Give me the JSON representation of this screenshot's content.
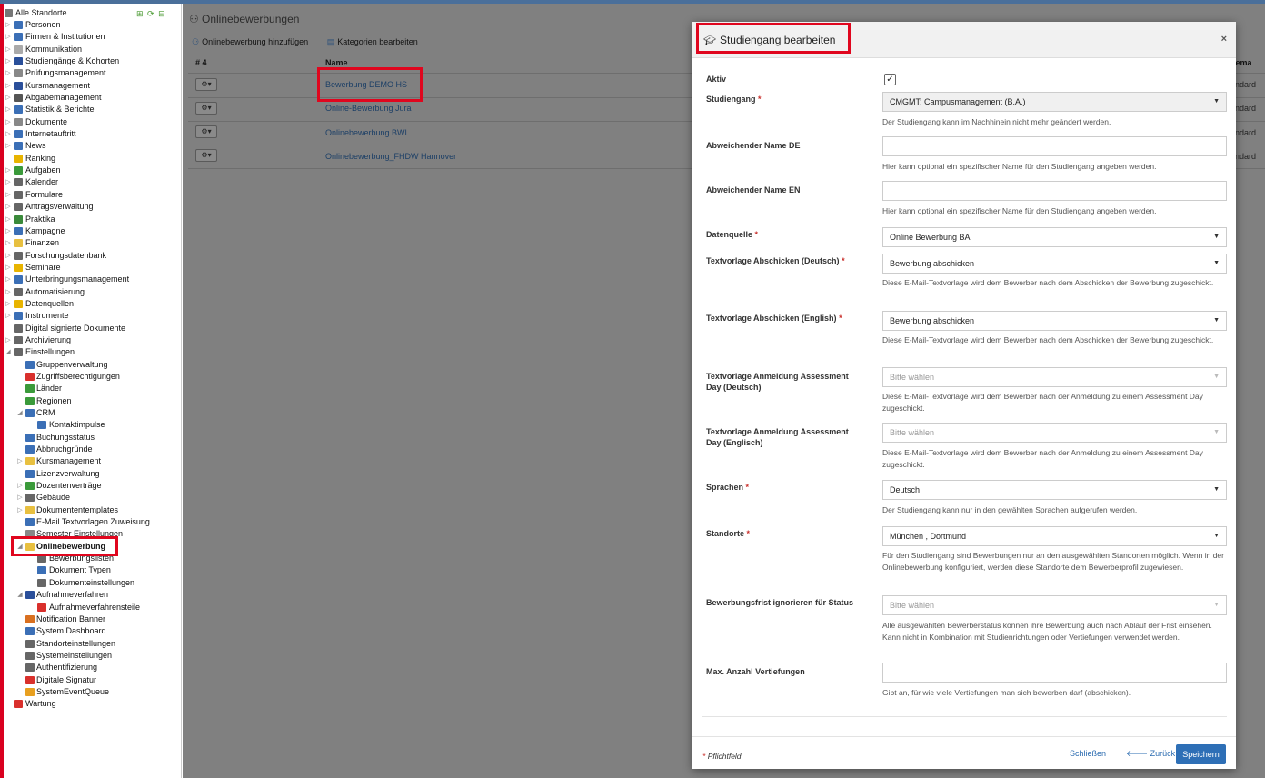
{
  "sidebar": {
    "root_label": "Alle Standorte",
    "items": [
      {
        "label": "Personen",
        "level": 0,
        "icon": "persons-icon",
        "color": "#3b6fb6",
        "arrow": "▷"
      },
      {
        "label": "Firmen & Institutionen",
        "level": 0,
        "icon": "company-icon",
        "color": "#3b6fb6",
        "arrow": "▷"
      },
      {
        "label": "Kommunikation",
        "level": 0,
        "icon": "mail-icon",
        "color": "#aaaaaa",
        "arrow": "▷"
      },
      {
        "label": "Studiengänge & Kohorten",
        "level": 0,
        "icon": "study-icon",
        "color": "#2a4f9a",
        "arrow": "▷"
      },
      {
        "label": "Prüfungsmanagement",
        "level": 0,
        "icon": "exam-icon",
        "color": "#888888",
        "arrow": "▷"
      },
      {
        "label": "Kursmanagement",
        "level": 0,
        "icon": "course-icon",
        "color": "#2a4f9a",
        "arrow": "▷"
      },
      {
        "label": "Abgabemanagement",
        "level": 0,
        "icon": "submission-icon",
        "color": "#555555",
        "arrow": "▷"
      },
      {
        "label": "Statistik & Berichte",
        "level": 0,
        "icon": "chart-icon",
        "color": "#3b6fb6",
        "arrow": "▷"
      },
      {
        "label": "Dokumente",
        "level": 0,
        "icon": "folder-icon",
        "color": "#888888",
        "arrow": "▷"
      },
      {
        "label": "Internetauftritt",
        "level": 0,
        "icon": "globe-icon",
        "color": "#3b6fb6",
        "arrow": "▷"
      },
      {
        "label": "News",
        "level": 0,
        "icon": "info-icon",
        "color": "#3b6fb6",
        "arrow": "▷"
      },
      {
        "label": "Ranking",
        "level": 0,
        "icon": "star-icon",
        "color": "#e8b400",
        "arrow": ""
      },
      {
        "label": "Aufgaben",
        "level": 0,
        "icon": "tasks-icon",
        "color": "#3a9a3a",
        "arrow": "▷"
      },
      {
        "label": "Kalender",
        "level": 0,
        "icon": "calendar-icon",
        "color": "#666666",
        "arrow": "▷"
      },
      {
        "label": "Formulare",
        "level": 0,
        "icon": "form-icon",
        "color": "#666666",
        "arrow": "▷"
      },
      {
        "label": "Antragsverwaltung",
        "level": 0,
        "icon": "application-icon",
        "color": "#666666",
        "arrow": "▷"
      },
      {
        "label": "Praktika",
        "level": 0,
        "icon": "internship-icon",
        "color": "#3a8a3a",
        "arrow": "▷"
      },
      {
        "label": "Kampagne",
        "level": 0,
        "icon": "campaign-icon",
        "color": "#3b6fb6",
        "arrow": "▷"
      },
      {
        "label": "Finanzen",
        "level": 0,
        "icon": "finance-icon",
        "color": "#e8c040",
        "arrow": "▷"
      },
      {
        "label": "Forschungsdatenbank",
        "level": 0,
        "icon": "research-icon",
        "color": "#666666",
        "arrow": "▷"
      },
      {
        "label": "Seminare",
        "level": 0,
        "icon": "seminar-icon",
        "color": "#e8b400",
        "arrow": "▷"
      },
      {
        "label": "Unterbringungsmanagement",
        "level": 0,
        "icon": "building-icon",
        "color": "#3b6fb6",
        "arrow": "▷"
      },
      {
        "label": "Automatisierung",
        "level": 0,
        "icon": "gear-icon",
        "color": "#666666",
        "arrow": "▷"
      },
      {
        "label": "Datenquellen",
        "level": 0,
        "icon": "datasource-icon",
        "color": "#e8b400",
        "arrow": "▷"
      },
      {
        "label": "Instrumente",
        "level": 0,
        "icon": "instruments-icon",
        "color": "#3b6fb6",
        "arrow": "▷"
      },
      {
        "label": "Digital signierte Dokumente",
        "level": 0,
        "icon": "signed-doc-icon",
        "color": "#666666",
        "arrow": ""
      },
      {
        "label": "Archivierung",
        "level": 0,
        "icon": "archive-icon",
        "color": "#666666",
        "arrow": "▷"
      },
      {
        "label": "Einstellungen",
        "level": 0,
        "icon": "gear-icon",
        "color": "#666666",
        "arrow": "◢"
      },
      {
        "label": "Gruppenverwaltung",
        "level": 1,
        "icon": "group-icon",
        "color": "#3b6fb6",
        "arrow": ""
      },
      {
        "label": "Zugriffsberechtigungen",
        "level": 1,
        "icon": "shield-icon",
        "color": "#d9302c",
        "arrow": ""
      },
      {
        "label": "Länder",
        "level": 1,
        "icon": "globe-icon",
        "color": "#3a9a3a",
        "arrow": ""
      },
      {
        "label": "Regionen",
        "level": 1,
        "icon": "globe-icon",
        "color": "#3a9a3a",
        "arrow": ""
      },
      {
        "label": "CRM",
        "level": 1,
        "icon": "tag-icon",
        "color": "#3b6fb6",
        "arrow": "◢"
      },
      {
        "label": "Kontaktimpulse",
        "level": 2,
        "icon": "tag-icon",
        "color": "#3b6fb6",
        "arrow": ""
      },
      {
        "label": "Buchungsstatus",
        "level": 1,
        "icon": "tag-icon",
        "color": "#3b6fb6",
        "arrow": ""
      },
      {
        "label": "Abbruchgründe",
        "level": 1,
        "icon": "tag-icon",
        "color": "#3b6fb6",
        "arrow": ""
      },
      {
        "label": "Kursmanagement",
        "level": 1,
        "icon": "folder-icon",
        "color": "#e8c040",
        "arrow": "▷"
      },
      {
        "label": "Lizenzverwaltung",
        "level": 1,
        "icon": "tag-icon",
        "color": "#3b6fb6",
        "arrow": ""
      },
      {
        "label": "Dozentenverträge",
        "level": 1,
        "icon": "contract-icon",
        "color": "#3a9a3a",
        "arrow": "▷"
      },
      {
        "label": "Gebäude",
        "level": 1,
        "icon": "house-icon",
        "color": "#666666",
        "arrow": "▷"
      },
      {
        "label": "Dokumententemplates",
        "level": 1,
        "icon": "folder-icon",
        "color": "#e8c040",
        "arrow": "▷"
      },
      {
        "label": "E-Mail Textvorlagen Zuweisung",
        "level": 1,
        "icon": "at-icon",
        "color": "#3b6fb6",
        "arrow": ""
      },
      {
        "label": "Semester Einstellungen",
        "level": 1,
        "icon": "semester-icon",
        "color": "#888888",
        "arrow": ""
      },
      {
        "label": "Onlinebewerbung",
        "level": 1,
        "icon": "application-icon",
        "color": "#e8c040",
        "arrow": "◢",
        "selected": true
      },
      {
        "label": "Bewerbungslisten",
        "level": 2,
        "icon": "list-icon",
        "color": "#666666",
        "arrow": ""
      },
      {
        "label": "Dokument Typen",
        "level": 2,
        "icon": "doc-type-icon",
        "color": "#3b6fb6",
        "arrow": ""
      },
      {
        "label": "Dokumenteinstellungen",
        "level": 2,
        "icon": "doc-settings-icon",
        "color": "#666666",
        "arrow": ""
      },
      {
        "label": "Aufnahmeverfahren",
        "level": 1,
        "icon": "admission-icon",
        "color": "#2a4f9a",
        "arrow": "◢"
      },
      {
        "label": "Aufnahmeverfahrensteile",
        "level": 2,
        "icon": "admission-part-icon",
        "color": "#d9302c",
        "arrow": ""
      },
      {
        "label": "Notification Banner",
        "level": 1,
        "icon": "bell-icon",
        "color": "#d97020",
        "arrow": ""
      },
      {
        "label": "System Dashboard",
        "level": 1,
        "icon": "dashboard-icon",
        "color": "#3b6fb6",
        "arrow": ""
      },
      {
        "label": "Standorteinstellungen",
        "level": 1,
        "icon": "gear-icon",
        "color": "#666666",
        "arrow": ""
      },
      {
        "label": "Systemeinstellungen",
        "level": 1,
        "icon": "gear-icon",
        "color": "#666666",
        "arrow": ""
      },
      {
        "label": "Authentifizierung",
        "level": 1,
        "icon": "gear-icon",
        "color": "#666666",
        "arrow": ""
      },
      {
        "label": "Digitale Signatur",
        "level": 1,
        "icon": "shield-icon",
        "color": "#d9302c",
        "arrow": ""
      },
      {
        "label": "SystemEventQueue",
        "level": 1,
        "icon": "queue-icon",
        "color": "#e8a020",
        "arrow": ""
      },
      {
        "label": "Wartung",
        "level": 0,
        "icon": "maintenance-icon",
        "color": "#d9302c",
        "arrow": ""
      }
    ]
  },
  "page": {
    "title": "Onlinebewerbungen",
    "toolbar": {
      "add_label": "Onlinebewerbung hinzufügen",
      "categories_label": "Kategorien bearbeiten"
    },
    "table": {
      "count_header": "# 4",
      "name_header": "Name",
      "schema_header": "hema",
      "rows": [
        {
          "name": "Bewerbung DEMO HS",
          "schema": "andard"
        },
        {
          "name": "Online-Bewerbung Jura",
          "schema": "andard"
        },
        {
          "name": "Onlinebewerbung BWL",
          "schema": "andard"
        },
        {
          "name": "Onlinebewerbung_FHDW Hannover",
          "schema": "andard"
        }
      ]
    }
  },
  "modal": {
    "title": "Studiengang bearbeiten",
    "close": "×",
    "fields": {
      "aktiv": {
        "label": "Aktiv",
        "checked": true
      },
      "studiengang": {
        "label": "Studiengang",
        "value": "CMGMT: Campusmanagement (B.A.)",
        "hint": "Der Studiengang kann im Nachhinein nicht mehr geändert werden."
      },
      "name_de": {
        "label": "Abweichender Name DE",
        "value": "",
        "hint": "Hier kann optional ein spezifischer Name für den Studiengang angeben werden."
      },
      "name_en": {
        "label": "Abweichender Name EN",
        "value": "",
        "hint": "Hier kann optional ein spezifischer Name für den Studiengang angeben werden."
      },
      "datenquelle": {
        "label": "Datenquelle",
        "value": "Online Bewerbung BA"
      },
      "tv_abschicken_de": {
        "label": "Textvorlage Abschicken (Deutsch)",
        "value": "Bewerbung abschicken",
        "hint": "Diese E-Mail-Textvorlage wird dem Bewerber nach dem Abschicken der Bewerbung zugeschickt."
      },
      "tv_abschicken_en": {
        "label": "Textvorlage Abschicken (English)",
        "value": "Bewerbung abschicken",
        "hint": "Diese E-Mail-Textvorlage wird dem Bewerber nach dem Abschicken der Bewerbung zugeschickt."
      },
      "tv_assessment_de": {
        "label": "Textvorlage Anmeldung Assessment Day (Deutsch)",
        "value": "Bitte wählen",
        "hint": "Diese E-Mail-Textvorlage wird dem Bewerber nach der Anmeldung zu einem Assessment Day zugeschickt."
      },
      "tv_assessment_en": {
        "label": "Textvorlage Anmeldung Assessment Day (Englisch)",
        "value": "Bitte wählen",
        "hint": "Diese E-Mail-Textvorlage wird dem Bewerber nach der Anmeldung zu einem Assessment Day zugeschickt."
      },
      "sprachen": {
        "label": "Sprachen",
        "value": "Deutsch",
        "hint": "Der Studiengang kann nur in den gewählten Sprachen aufgerufen werden."
      },
      "standorte": {
        "label": "Standorte",
        "value": "München , Dortmund",
        "hint": "Für den Studiengang sind Bewerbungen nur an den ausgewählten Standorten möglich. Wenn in der Onlinebewerbung konfiguriert, werden diese Standorte dem Bewerberprofil zugewiesen."
      },
      "frist_status": {
        "label": "Bewerbungsfrist ignorieren für Status",
        "value": "Bitte wählen",
        "hint": "Alle ausgewählten Bewerberstatus können ihre Bewerbung auch nach Ablauf der Frist einsehen. Kann nicht in Kombination mit Studienrichtungen oder Vertiefungen verwendet werden."
      },
      "max_vertiefungen": {
        "label": "Max. Anzahl Vertiefungen",
        "value": "",
        "hint": "Gibt an, für wie viele Vertiefungen man sich bewerben darf (abschicken)."
      }
    },
    "footer": {
      "required_note": "Pflichtfeld",
      "required_star": "*",
      "close_label": "Schließen",
      "back_label": "Zurück",
      "save_label": "Speichern"
    }
  },
  "colors": {
    "highlight": "#e0061e",
    "link": "#2a6bb0",
    "primary": "#2e6fb6",
    "required": "#c9302c"
  }
}
